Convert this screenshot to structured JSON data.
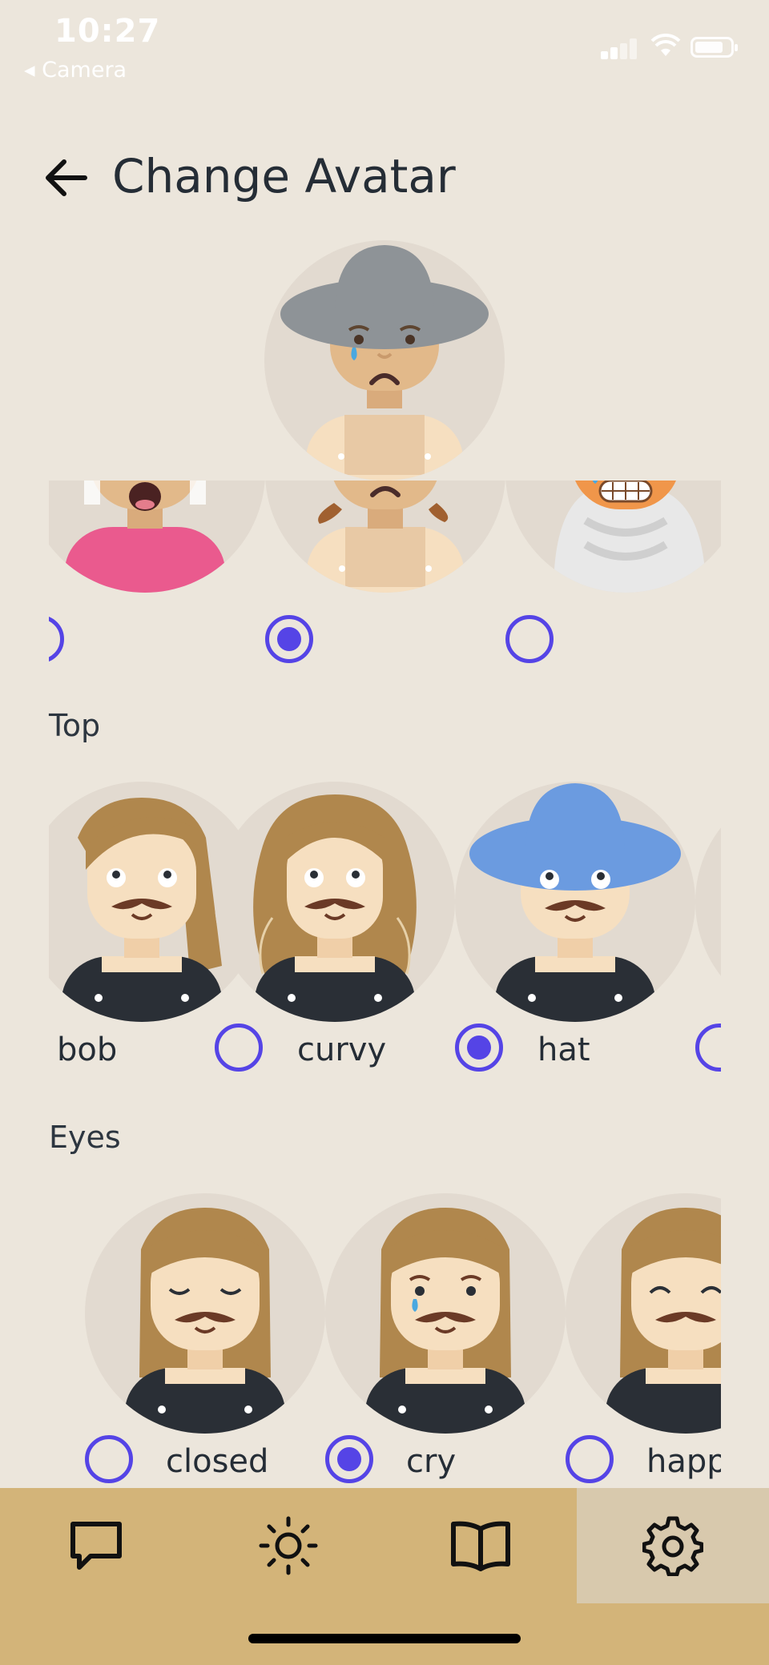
{
  "status_bar": {
    "time": "10:27",
    "back_app": "◂ Camera"
  },
  "header": {
    "title": "Change Avatar"
  },
  "preview": {
    "top": "hat",
    "eyes": "cry",
    "mouth": "sad",
    "hat_color": "#8e9397"
  },
  "mouth_row": {
    "options": [
      {
        "selected": false
      },
      {
        "selected": true
      },
      {
        "selected": false
      }
    ]
  },
  "top_section": {
    "label": "Top",
    "options": [
      {
        "label": "bob",
        "selected": false
      },
      {
        "label": "curvy",
        "selected": false
      },
      {
        "label": "hat",
        "selected": true
      }
    ]
  },
  "eyes_section": {
    "label": "Eyes",
    "options": [
      {
        "label": "closed",
        "selected": false
      },
      {
        "label": "cry",
        "selected": true
      },
      {
        "label": "happ",
        "selected": false
      }
    ]
  },
  "nav": {
    "items": [
      {
        "icon": "chat-icon",
        "active": false
      },
      {
        "icon": "sun-icon",
        "active": false
      },
      {
        "icon": "book-icon",
        "active": false
      },
      {
        "icon": "gear-icon",
        "active": true
      }
    ]
  },
  "colors": {
    "accent": "#5544e6",
    "nav_bg": "#d3b479",
    "page_bg": "#ece6dc",
    "skin": "#e2b98a",
    "hair": "#b0874d",
    "hat_blue": "#6b9be0"
  }
}
